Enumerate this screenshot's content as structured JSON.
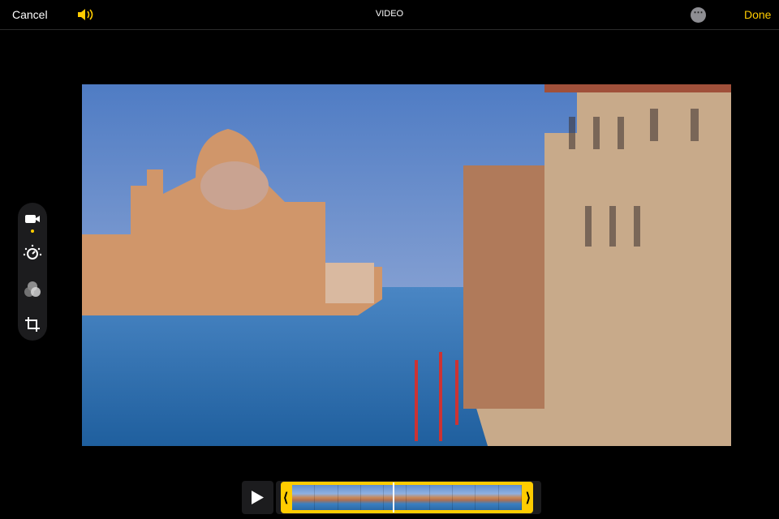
{
  "topbar": {
    "cancel_label": "Cancel",
    "title": "VIDEO",
    "done_label": "Done",
    "more_label": "⋯"
  },
  "colors": {
    "accent": "#ffcc00",
    "background": "#000000",
    "panel": "#1c1c1e"
  },
  "tools": [
    {
      "icon": "video-camera-icon",
      "active": true
    },
    {
      "icon": "adjust-dial-icon"
    },
    {
      "icon": "filters-icon"
    },
    {
      "icon": "crop-rotate-icon"
    }
  ],
  "timeline": {
    "frame_count": 10,
    "handle_left": "⟨",
    "handle_right": "⟩"
  }
}
